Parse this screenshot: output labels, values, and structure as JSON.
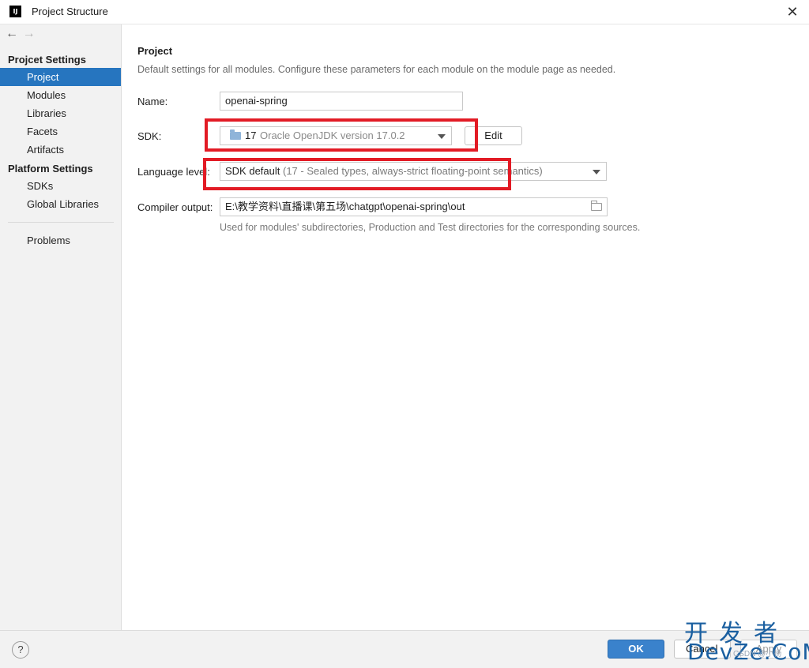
{
  "window": {
    "app_icon_text": "IJ",
    "title": "Project Structure",
    "close_glyph": "✕"
  },
  "nav": {
    "back_glyph": "←",
    "forward_glyph": "→"
  },
  "sidebar": {
    "project_settings_header": "Projcet Settings",
    "project_settings_items": [
      {
        "label": "Project",
        "selected": true
      },
      {
        "label": "Modules"
      },
      {
        "label": "Libraries"
      },
      {
        "label": "Facets"
      },
      {
        "label": "Artifacts"
      }
    ],
    "platform_settings_header": "Platform Settings",
    "platform_settings_items": [
      {
        "label": "SDKs"
      },
      {
        "label": "Global Libraries"
      }
    ],
    "other_items": [
      {
        "label": "Problems"
      }
    ]
  },
  "main": {
    "title": "Project",
    "description": "Default settings for all modules. Configure these parameters for each module on the module page as needed.",
    "name_label": "Name:",
    "name_value": "openai-spring",
    "sdk_label": "SDK:",
    "sdk_version": "17",
    "sdk_name": "Oracle OpenJDK version 17.0.2",
    "edit_label": "Edit",
    "language_level_label": "Language level:",
    "language_level_value": "SDK default",
    "language_level_detail": "(17 - Sealed types, always-strict floating-point semantics)",
    "compiler_output_label": "Compiler output:",
    "compiler_output_value": "E:\\教学资料\\直播课\\第五场\\chatgpt\\openai-spring\\out",
    "compiler_output_hint": "Used for modules' subdirectories, Production and Test directories for the corresponding sources."
  },
  "footer": {
    "help_glyph": "?",
    "ok_label": "OK",
    "cancel_label": "Cancel",
    "apply_label": "Apply"
  },
  "watermark": {
    "top": "开发者",
    "bottom": "DevZe.CoM",
    "small": "CSDN @小杨"
  },
  "colors": {
    "selection": "#2675bf",
    "ok_button": "#3a82cc",
    "highlight_box": "#e21b25"
  },
  "icons": {
    "sdk": "folder-icon",
    "compiler_output_browse": "folder-icon",
    "dropdown": "chevron-down-icon"
  }
}
